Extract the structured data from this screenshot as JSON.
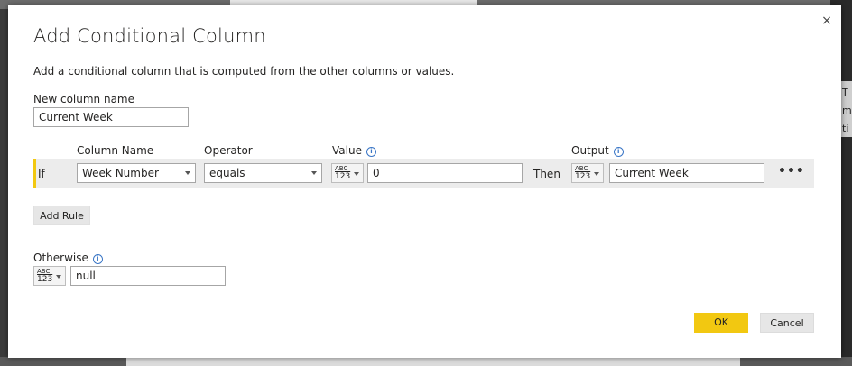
{
  "dialog": {
    "title": "Add Conditional Column",
    "description": "Add a conditional column that is computed from the other columns or values.",
    "close_icon": "×"
  },
  "new_column": {
    "label": "New column name",
    "value": "Current Week"
  },
  "headers": {
    "column_name": "Column Name",
    "operator": "Operator",
    "value": "Value",
    "output": "Output",
    "info_icon": "i"
  },
  "rule": {
    "keyword_if": "If",
    "column": "Week Number",
    "operator": "equals",
    "value": "0",
    "keyword_then": "Then",
    "output": "Current Week",
    "more_icon": "•••"
  },
  "type_selector": {
    "line1": "ABC",
    "line2": "123"
  },
  "buttons": {
    "add_rule": "Add Rule",
    "ok": "OK",
    "cancel": "Cancel"
  },
  "otherwise": {
    "label": "Otherwise",
    "value": "null"
  },
  "background": {
    "right_text_1": "T",
    "right_text_2": "m",
    "right_text_3": "ti"
  },
  "colors": {
    "accent": "#f2c811",
    "info": "#3a76c6"
  }
}
